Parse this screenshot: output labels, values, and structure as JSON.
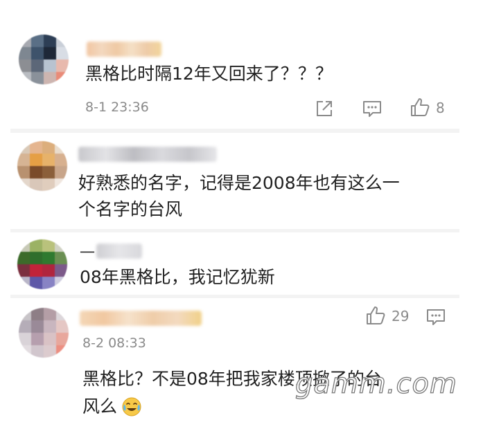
{
  "comments": [
    {
      "text_lines": [
        "黑格比时隔12年又回来了？？？"
      ],
      "date": "8-1 23:36",
      "likes": "8"
    },
    {
      "text_lines": [
        "好熟悉的名字，记得是2008年也有这么一",
        "个名字的台风"
      ]
    },
    {
      "username_visible": "一",
      "text_lines": [
        "08年黑格比，我记忆犹新"
      ]
    },
    {
      "text_lines": [
        "黑格比？不是08年把我家楼顶掀了的台",
        "风么"
      ],
      "date": "8-2 08:33",
      "likes": "29",
      "emoji": "crying-laughing-emoji"
    }
  ],
  "watermark": "gamm.com",
  "colors": {
    "link_gray": "#8a8a8a",
    "card_bg": "#ffffff",
    "separator": "#f3f3f3"
  }
}
